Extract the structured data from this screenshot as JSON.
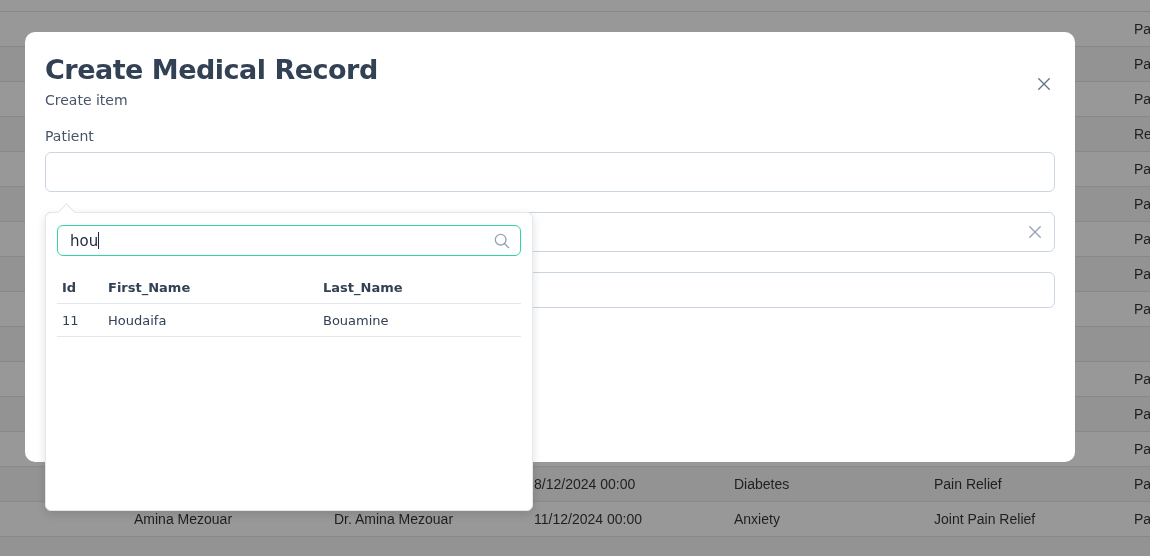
{
  "background_table": {
    "rows": [
      {
        "column_6": "Pa"
      },
      {
        "column_6": "Pa"
      },
      {
        "column_6": "Pa"
      },
      {
        "column_6": "Re"
      },
      {
        "column_6": "Pa"
      },
      {
        "column_6": "Pa"
      },
      {
        "column_6": "Pa"
      },
      {
        "column_6": "Pa"
      },
      {
        "column_6": "Pa"
      },
      {},
      {
        "column_6": "Pa"
      },
      {
        "column_6": "Pa"
      },
      {
        "column_6": "Pa"
      },
      {
        "date": "8/12/2024 00:00",
        "diagnosis": "Diabetes",
        "treatment": "Pain Relief",
        "column_6": "Pa"
      },
      {
        "patient": "Amina Mezouar",
        "doctor": "Dr. Amina Mezouar",
        "date": "11/12/2024 00:00",
        "diagnosis": "Anxiety",
        "treatment": "Joint Pain Relief",
        "column_6": "Pa"
      },
      {}
    ]
  },
  "modal": {
    "title": "Create Medical Record",
    "subtitle": "Create item",
    "fields": [
      {
        "label": "Patient",
        "clearable": false
      },
      {
        "clearable": true
      },
      {
        "clearable": false
      }
    ]
  },
  "dropdown": {
    "search_value": "hou",
    "columns": [
      "Id",
      "First_Name",
      "Last_Name"
    ],
    "rows": [
      {
        "cells": [
          "11",
          "Houdaifa",
          "Bouamine"
        ]
      }
    ]
  }
}
